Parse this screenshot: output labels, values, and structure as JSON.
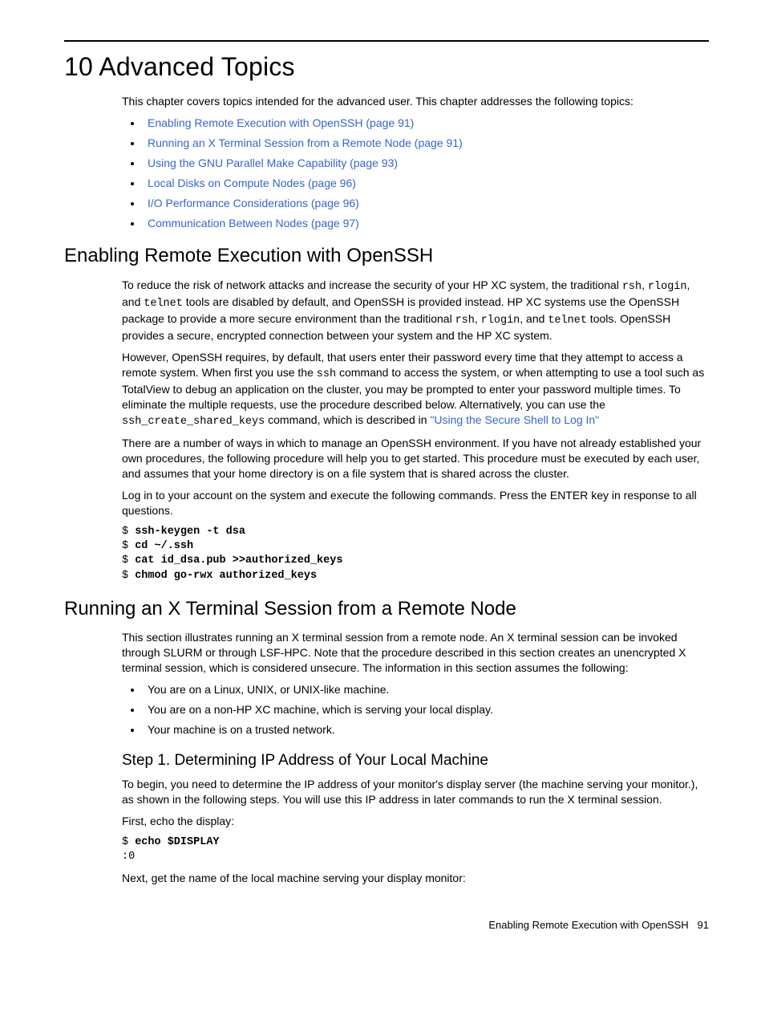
{
  "chapter_title": "10 Advanced Topics",
  "intro": "This chapter covers topics intended for the advanced user. This chapter addresses the following topics:",
  "toc": [
    "Enabling Remote Execution with OpenSSH (page 91)",
    "Running an X Terminal Session from a Remote Node (page 91)",
    "Using the GNU Parallel Make Capability (page 93)",
    "Local Disks on Compute Nodes (page 96)",
    "I/O Performance Considerations (page 96)",
    "Communication Between Nodes (page 97)"
  ],
  "sec1": {
    "heading": "Enabling Remote Execution with OpenSSH",
    "p1_a": "To reduce the risk of network attacks and increase the security of your HP XC system, the traditional ",
    "p1_code1": "rsh",
    "p1_b": ", ",
    "p1_code2": "rlogin",
    "p1_c": ", and ",
    "p1_code3": "telnet",
    "p1_d": " tools are disabled by default, and OpenSSH is provided instead. HP XC systems use the OpenSSH package to provide a more secure environment than the traditional ",
    "p1_code4": "rsh",
    "p1_e": ", ",
    "p1_code5": "rlogin",
    "p1_f": ", and ",
    "p1_code6": "telnet",
    "p1_g": " tools. OpenSSH provides a secure, encrypted connection between your system and the HP XC system.",
    "p2_a": "However, OpenSSH requires, by default, that users enter their password every time that they attempt to access a remote system. When first you use the ",
    "p2_code1": "ssh",
    "p2_b": " command to access the system, or when attempting to use a tool such as TotalView to debug an application on the cluster, you may be prompted to enter your password multiple times. To eliminate the multiple requests, use the procedure described below. Alternatively, you can use the ",
    "p2_code2": "ssh_create_shared_keys",
    "p2_c": " command, which is described in   ",
    "p2_link": "\"Using the Secure Shell to Log In\"",
    "p3": "There are a number of ways in which to manage an OpenSSH environment. If you have not already established your own procedures, the following procedure will help you to get started. This procedure must be executed by each user, and assumes that your home directory is on a file system that is shared across the cluster.",
    "p4": "Log in to your account on the system and execute the following commands. Press the ENTER key in response to all questions.",
    "cmds": {
      "prompt": "$ ",
      "l1": "ssh-keygen -t dsa",
      "l2": "cd ~/.ssh",
      "l3": "cat id_dsa.pub >>authorized_keys",
      "l4": "chmod go-rwx authorized_keys"
    }
  },
  "sec2": {
    "heading": "Running an X Terminal Session from a Remote Node",
    "p1": "This section illustrates running an X terminal session from a remote node. An X terminal session can be invoked through SLURM or through LSF-HPC. Note that the procedure described in this section creates an unencrypted X terminal session, which is considered unsecure. The information in this section assumes the following:",
    "bullets": [
      "You are on a Linux, UNIX, or UNIX-like machine.",
      "You are on a non-HP XC machine, which is serving your local display.",
      "Your machine is on a trusted network."
    ],
    "step1_heading": "Step 1. Determining IP Address of Your Local Machine",
    "step1_p1": "To begin, you need to determine the IP address of your monitor's display server (the machine serving your monitor.), as shown in the following steps. You will use this IP address in later commands to run the X terminal session.",
    "step1_p2": "First, echo the display:",
    "cmd1_prompt": "$ ",
    "cmd1": "echo $DISPLAY",
    "cmd1_out": ":0",
    "step1_p3": "Next, get the name of the local machine serving your display monitor:"
  },
  "footer": {
    "text": "Enabling Remote Execution with OpenSSH",
    "page": "91"
  }
}
